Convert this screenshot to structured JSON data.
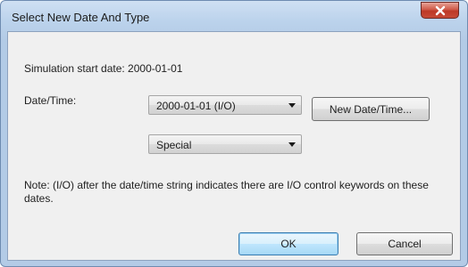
{
  "window": {
    "title": "Select New Date And Type"
  },
  "dialog": {
    "start_date_text": "Simulation start date: 2000-01-01",
    "datetime_label": "Date/Time:",
    "date_select_value": "2000-01-01 (I/O)",
    "type_select_value": "Special",
    "new_datetime_label": "New Date/Time...",
    "note": "Note: (I/O) after the date/time string indicates there are I/O control keywords on these dates.",
    "ok_label": "OK",
    "cancel_label": "Cancel"
  }
}
